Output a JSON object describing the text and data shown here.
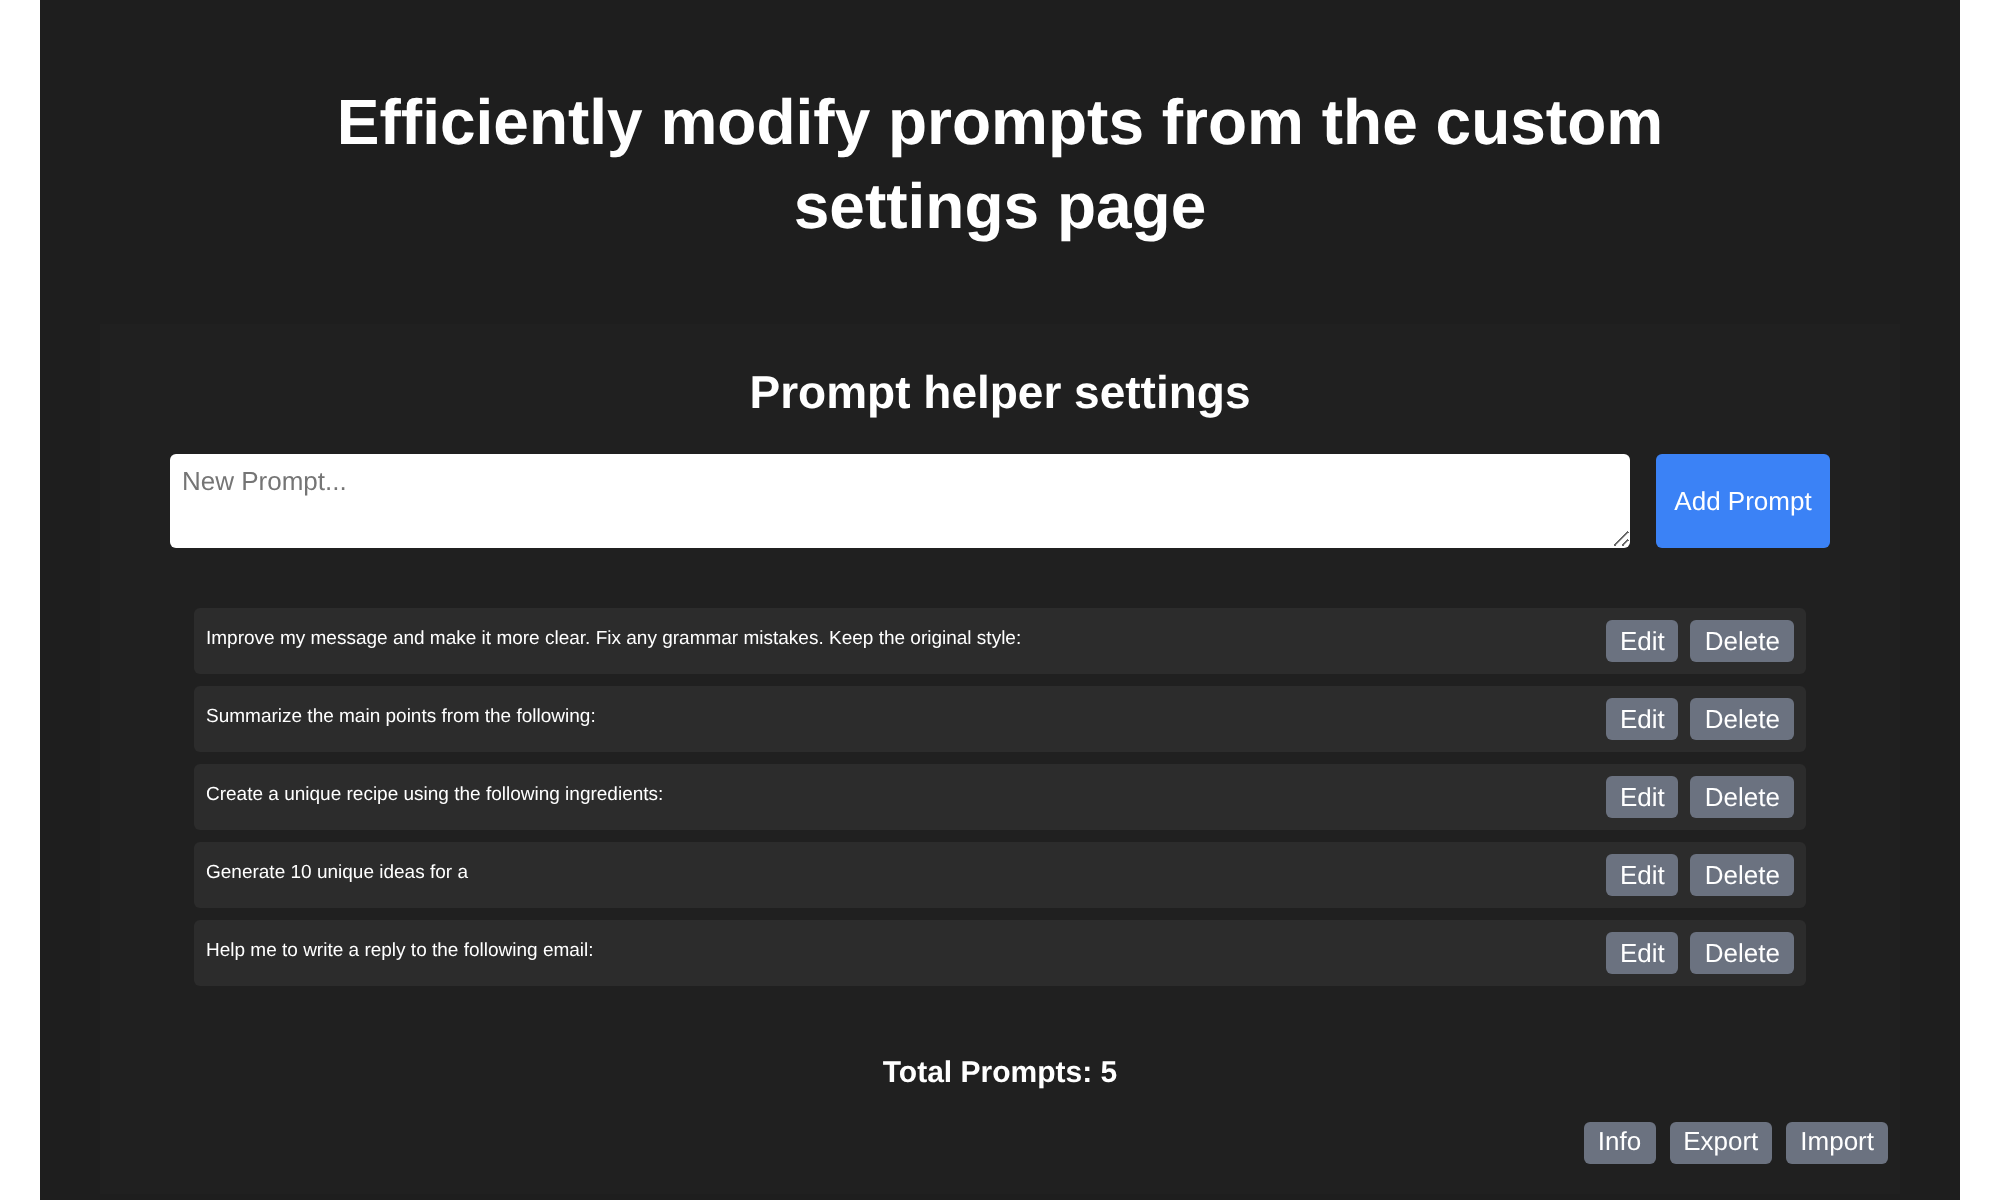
{
  "page_title": "Efficiently modify prompts from the custom settings page",
  "settings": {
    "title": "Prompt helper settings",
    "new_prompt": {
      "placeholder": "New Prompt..."
    },
    "add_button": "Add Prompt",
    "prompts": [
      {
        "text": "Improve my message and make it more clear. Fix any grammar mistakes. Keep the original style:",
        "actions": [
          "Edit",
          "Delete"
        ]
      },
      {
        "text": "Summarize the main points from the following:",
        "actions": [
          "Edit",
          "Delete"
        ]
      },
      {
        "text": "Create a unique recipe using the following ingredients:",
        "actions": [
          "Edit",
          "Delete"
        ]
      },
      {
        "text": "Generate 10 unique ideas for a",
        "actions": [
          "Edit",
          "Delete"
        ]
      },
      {
        "text": "Help me to write a reply to the following email:",
        "actions": [
          "Edit",
          "Delete"
        ]
      }
    ],
    "total": "Total Prompts: 5",
    "footer_buttons": [
      "Info",
      "Export",
      "Import"
    ]
  }
}
